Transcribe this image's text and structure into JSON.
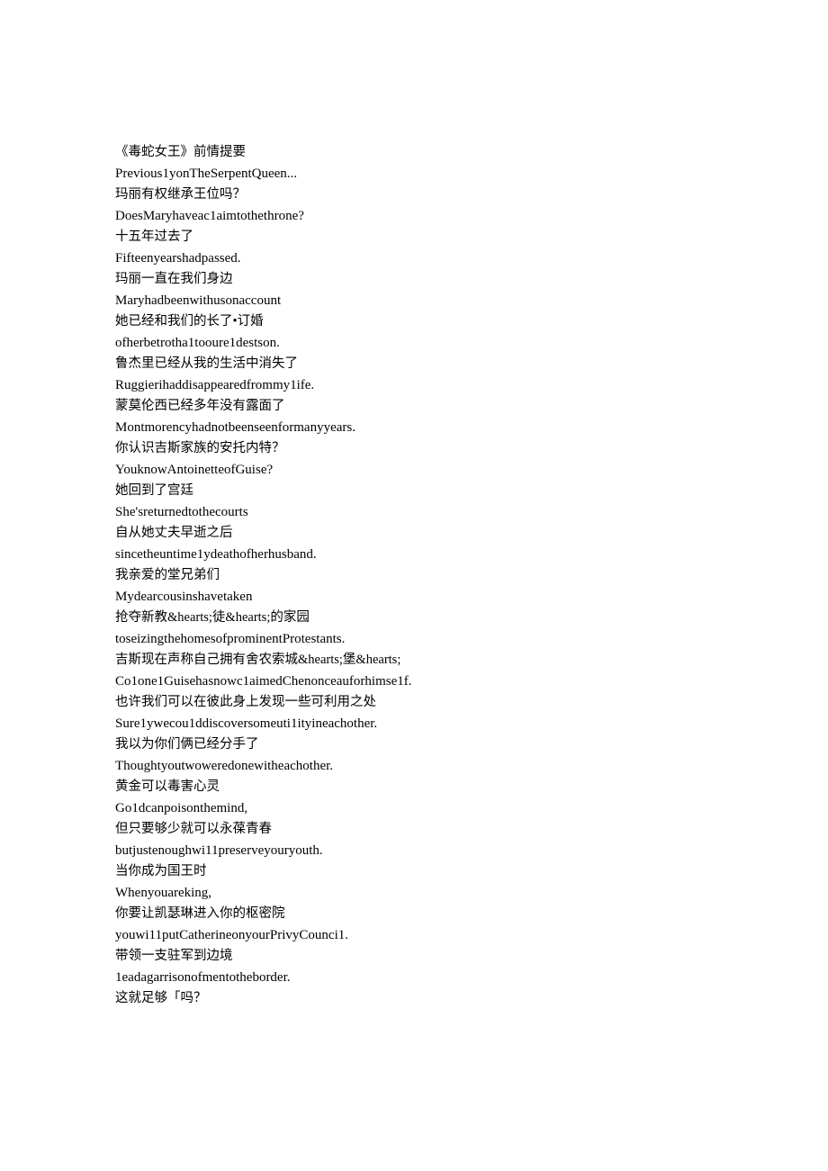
{
  "document": {
    "title": "《毒蛇女王》前情提要",
    "background_color": "#ffffff",
    "text_color": "#000000",
    "lines": [
      {
        "lang": "zh",
        "text": "《毒蛇女王》前情提要"
      },
      {
        "lang": "en",
        "text": "Previous1yonTheSerpentQueen..."
      },
      {
        "lang": "zh",
        "text": "玛丽有权继承王位吗？"
      },
      {
        "lang": "en",
        "text": "DoesMaryhaveac1aimtothethrone?"
      },
      {
        "lang": "zh",
        "text": "十五年过去了"
      },
      {
        "lang": "en",
        "text": "Fifteenyearshadpassed."
      },
      {
        "lang": "zh",
        "text": "玛丽一直在我们身边"
      },
      {
        "lang": "en",
        "text": "Maryhadbeenwithusonaccount"
      },
      {
        "lang": "zh",
        "text": "她已经和我们的长了•订婚"
      },
      {
        "lang": "en",
        "text": "ofherbetrotha1tooure1destson."
      },
      {
        "lang": "zh",
        "text": "鲁杰里已经从我的生活中消失了"
      },
      {
        "lang": "en",
        "text": "Ruggierihaddisappearedfrommy1ife."
      },
      {
        "lang": "zh",
        "text": "蒙莫伦西已经多年没有露面了"
      },
      {
        "lang": "en",
        "text": "Montmorencyhadnotbeenseenformanyyears."
      },
      {
        "lang": "zh",
        "text": "你认识吉斯家族的安托内特？"
      },
      {
        "lang": "en",
        "text": "YouknowAntoinetteofGuise?"
      },
      {
        "lang": "zh",
        "text": "她回到了宫廷"
      },
      {
        "lang": "en",
        "text": "She'sreturnedtothecourts"
      },
      {
        "lang": "zh",
        "text": "自从她丈夫早逝之后"
      },
      {
        "lang": "en",
        "text": "sincetheuntime1ydeathofherhusband."
      },
      {
        "lang": "zh",
        "text": "我亲爱的堂兄弟们"
      },
      {
        "lang": "en",
        "text": "Mydearcousinshavetaken"
      },
      {
        "lang": "zh",
        "text": "抢夺新教&hearts;徒&hearts;的家园"
      },
      {
        "lang": "en",
        "text": "toseizingthehomesofprominentProtestants."
      },
      {
        "lang": "zh",
        "text": "吉斯现在声称自己拥有舍农索城&hearts;堡&hearts;"
      },
      {
        "lang": "en",
        "text": "Co1one1Guisehasnowc1aimedChenonceauforhimse1f."
      },
      {
        "lang": "zh",
        "text": "也许我们可以在彼此身上发现一些可利用之处"
      },
      {
        "lang": "en",
        "text": "Sure1ywecou1ddiscoversomeuti1ityineachother."
      },
      {
        "lang": "zh",
        "text": "我以为你们俩已经分手了"
      },
      {
        "lang": "en",
        "text": "Thoughtyoutwoweredonewitheachother."
      },
      {
        "lang": "zh",
        "text": "黄金可以毒害心灵"
      },
      {
        "lang": "en",
        "text": "Go1dcanpoisonthemind,"
      },
      {
        "lang": "zh",
        "text": "但只要够少就可以永葆青春"
      },
      {
        "lang": "en",
        "text": "butjustenoughwi11preserveyouryouth."
      },
      {
        "lang": "zh",
        "text": "当你成为国王时"
      },
      {
        "lang": "en",
        "text": "Whenyouareking,"
      },
      {
        "lang": "zh",
        "text": "你要让凯瑟琳进入你的枢密院"
      },
      {
        "lang": "en",
        "text": "youwi11putCatherineonyourPrivyCounci1."
      },
      {
        "lang": "zh",
        "text": "带领一支驻军到边境"
      },
      {
        "lang": "en",
        "text": "1eadagarrisonofmentotheborder."
      },
      {
        "lang": "zh",
        "text": "这就足够「吗？"
      }
    ]
  }
}
